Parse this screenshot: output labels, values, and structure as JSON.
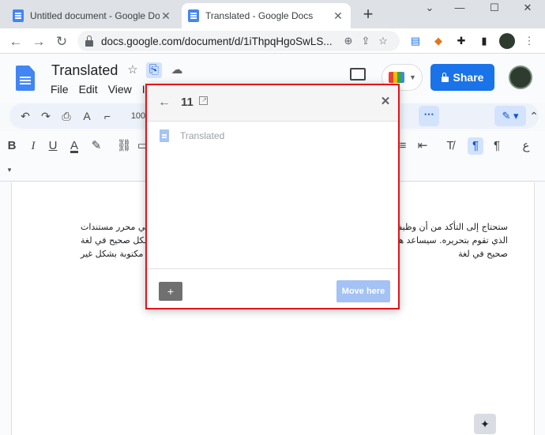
{
  "browser": {
    "tabs": [
      {
        "title": "Untitled document - Google Docs",
        "active": false
      },
      {
        "title": "Translated - Google Docs",
        "active": true
      }
    ],
    "new_tab": "+",
    "window_controls": {
      "minimize": "⌄",
      "restore": "—",
      "maximize": "☐",
      "close": "✕"
    },
    "url": "docs.google.com/document/d/1iThpqHgoSwLS...",
    "nav": {
      "back": "←",
      "forward": "→",
      "reload": "↻"
    }
  },
  "docs": {
    "title": "Translated",
    "menu": [
      "File",
      "Edit",
      "View",
      "In"
    ],
    "share_label": "Share",
    "zoom_partial": "100",
    "colors": {
      "share": "#1a73e8",
      "highlight": "#e3131b"
    }
  },
  "document": {
    "right_lines": [
      "ستحتاج إلى التأكد من أن وظيفة التد",
      "الذي تقوم بتحريره. سيساعد هذا في",
      "صحيح في لغة"
    ],
    "left_lines": [
      "في محرر مستندات",
      "بشكل صحيح في لغة",
      "مكتوبة بشكل غير",
      ""
    ]
  },
  "move_dialog": {
    "folder_name": "11",
    "item_label": "Translated",
    "move_button": "Move here",
    "back_icon": "←",
    "close_icon": "✕",
    "new_folder_icon": "+"
  }
}
